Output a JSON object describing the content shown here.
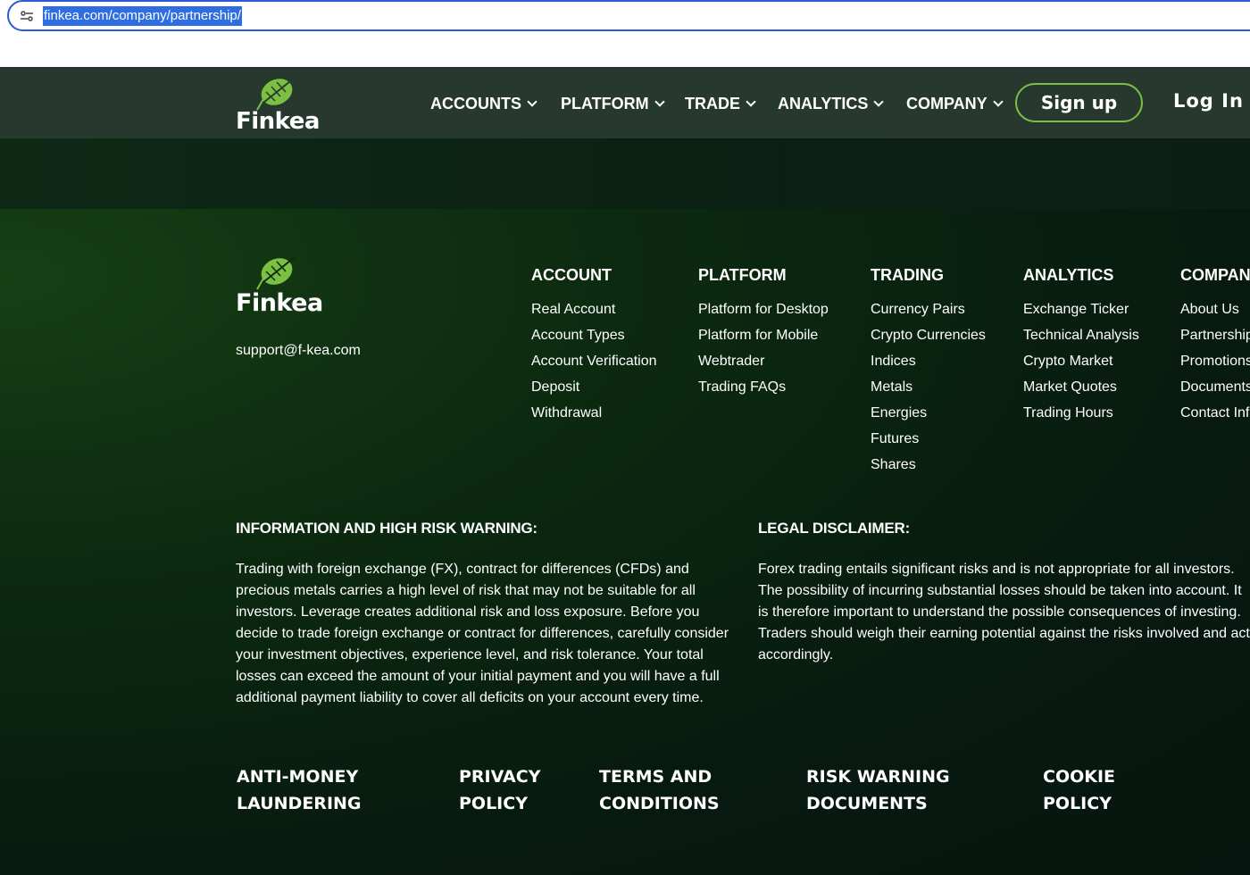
{
  "browser": {
    "url": "finkea.com/company/partnership/"
  },
  "header": {
    "logo_text": "Finkea",
    "nav": [
      {
        "label": "ACCOUNTS"
      },
      {
        "label": "PLATFORM"
      },
      {
        "label": "TRADE"
      },
      {
        "label": "ANALYTICS"
      },
      {
        "label": "COMPANY"
      }
    ],
    "signup_label": "Sign up",
    "login_label": "Log In"
  },
  "footer": {
    "logo_text": "Finkea",
    "support_email": "support@f-kea.com",
    "columns": [
      {
        "title": "ACCOUNT",
        "links": [
          "Real Account",
          "Account Types",
          "Account Verification",
          "Deposit",
          "Withdrawal"
        ]
      },
      {
        "title": "PLATFORM",
        "links": [
          "Platform for Desktop",
          "Platform for Mobile",
          "Webtrader",
          "Trading FAQs"
        ]
      },
      {
        "title": "TRADING",
        "links": [
          "Currency Pairs",
          "Crypto Currencies",
          "Indices",
          "Metals",
          "Energies",
          "Futures",
          "Shares"
        ]
      },
      {
        "title": "ANALYTICS",
        "links": [
          "Exchange Ticker",
          "Technical Analysis",
          "Crypto Market",
          "Market Quotes",
          "Trading Hours"
        ]
      },
      {
        "title": "COMPANY",
        "links": [
          "About Us",
          "Partnership",
          "Promotions",
          "Documents",
          "Contact Info"
        ]
      }
    ],
    "risk_warning": {
      "title": "INFORMATION AND HIGH RISK WARNING:",
      "text": "Trading with foreign exchange (FX), contract for differences (CFDs) and precious metals carries a high level of risk that may not be suitable for all investors. Leverage creates additional risk and loss exposure. Before you decide to trade foreign exchange or contract for differences, carefully consider your investment objectives, experience level, and risk tolerance. Your total losses can exceed the amount of your initial payment and you will have a full additional payment liability to cover all deficits on your account every time."
    },
    "legal_disclaimer": {
      "title": "LEGAL DISCLAIMER:",
      "text": "Forex trading entails significant risks and is not appropriate for all investors. The possibility of incurring substantial losses should be taken into account. It is therefore important to understand the possible consequences of investing. Traders should weigh their earning potential against the risks involved and act accordingly."
    },
    "bottom_links": [
      {
        "line1": "ANTI-MONEY",
        "line2": "LAUNDERING"
      },
      {
        "line1": "PRIVACY",
        "line2": "POLICY"
      },
      {
        "line1": "TERMS AND",
        "line2": "CONDITIONS"
      },
      {
        "line1": "RISK WARNING",
        "line2": "DOCUMENTS"
      },
      {
        "line1": "COOKIE",
        "line2": "POLICY"
      }
    ]
  },
  "colors": {
    "accent": "#7bc043",
    "header_bg": "#27392f",
    "url_highlight": "#2f6ee0"
  }
}
